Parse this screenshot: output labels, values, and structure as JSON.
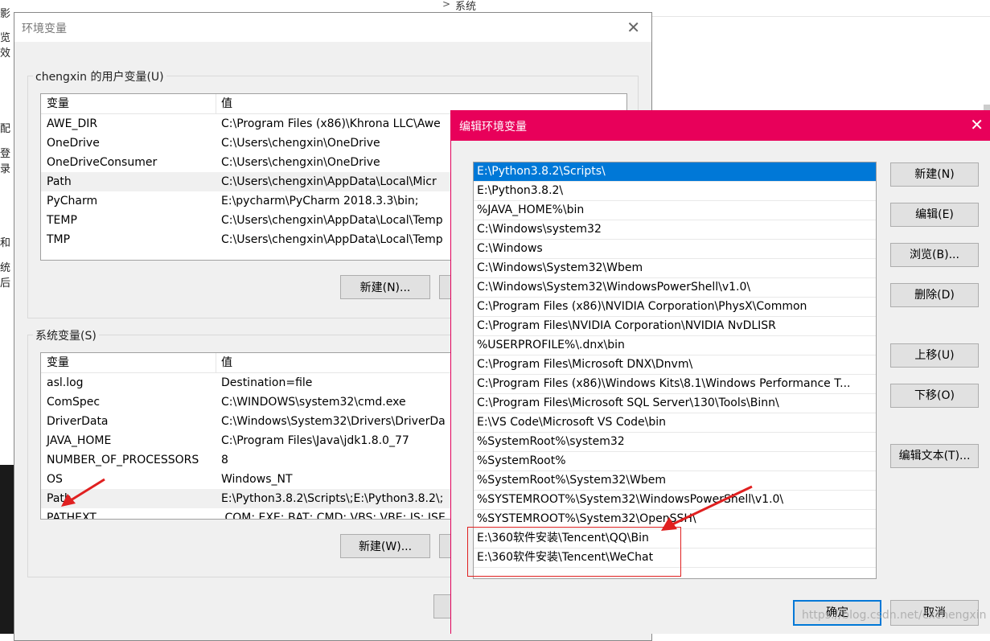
{
  "background": {
    "crumb_chevron": ">",
    "crumb_label": "系统",
    "left_fragments": [
      "影",
      "览效",
      "配",
      "登录",
      "和",
      "统后"
    ]
  },
  "env_dialog": {
    "title": "环境变量",
    "close_glyph": "✕",
    "user_vars": {
      "legend": "chengxin 的用户变量(U)",
      "headers": [
        "变量",
        "值"
      ],
      "rows": [
        {
          "name": "AWE_DIR",
          "value": "C:\\Program Files (x86)\\Khrona LLC\\Awe"
        },
        {
          "name": "OneDrive",
          "value": "C:\\Users\\chengxin\\OneDrive"
        },
        {
          "name": "OneDriveConsumer",
          "value": "C:\\Users\\chengxin\\OneDrive"
        },
        {
          "name": "Path",
          "value": "C:\\Users\\chengxin\\AppData\\Local\\Micr"
        },
        {
          "name": "PyCharm",
          "value": "E:\\pycharm\\PyCharm 2018.3.3\\bin;"
        },
        {
          "name": "TEMP",
          "value": "C:\\Users\\chengxin\\AppData\\Local\\Temp"
        },
        {
          "name": "TMP",
          "value": "C:\\Users\\chengxin\\AppData\\Local\\Temp"
        }
      ],
      "selected_row": 3,
      "new_button": "新建(N)..."
    },
    "system_vars": {
      "legend": "系统变量(S)",
      "headers": [
        "变量",
        "值"
      ],
      "rows": [
        {
          "name": "asl.log",
          "value": "Destination=file"
        },
        {
          "name": "ComSpec",
          "value": "C:\\WINDOWS\\system32\\cmd.exe"
        },
        {
          "name": "DriverData",
          "value": "C:\\Windows\\System32\\Drivers\\DriverDa"
        },
        {
          "name": "JAVA_HOME",
          "value": "C:\\Program Files\\Java\\jdk1.8.0_77"
        },
        {
          "name": "NUMBER_OF_PROCESSORS",
          "value": "8"
        },
        {
          "name": "OS",
          "value": "Windows_NT"
        },
        {
          "name": "Path",
          "value": "E:\\Python3.8.2\\Scripts\\;E:\\Python3.8.2\\;"
        },
        {
          "name": "PATHEXT",
          "value": ".COM;.EXE;.BAT;.CMD;.VBS;.VBE;.JS;.JSE"
        }
      ],
      "selected_row": 6,
      "new_button": "新建(W)..."
    }
  },
  "edit_dialog": {
    "title": "编辑环境变量",
    "close_glyph": "✕",
    "entries": [
      "E:\\Python3.8.2\\Scripts\\",
      "E:\\Python3.8.2\\",
      "%JAVA_HOME%\\bin",
      "C:\\Windows\\system32",
      "C:\\Windows",
      "C:\\Windows\\System32\\Wbem",
      "C:\\Windows\\System32\\WindowsPowerShell\\v1.0\\",
      "C:\\Program Files (x86)\\NVIDIA Corporation\\PhysX\\Common",
      "C:\\Program Files\\NVIDIA Corporation\\NVIDIA NvDLISR",
      "%USERPROFILE%\\.dnx\\bin",
      "C:\\Program Files\\Microsoft DNX\\Dnvm\\",
      "C:\\Program Files (x86)\\Windows Kits\\8.1\\Windows Performance T...",
      "C:\\Program Files\\Microsoft SQL Server\\130\\Tools\\Binn\\",
      "E:\\VS Code\\Microsoft VS Code\\bin",
      "%SystemRoot%\\system32",
      "%SystemRoot%",
      "%SystemRoot%\\System32\\Wbem",
      "%SYSTEMROOT%\\System32\\WindowsPowerShell\\v1.0\\",
      "%SYSTEMROOT%\\System32\\OpenSSH\\",
      "E:\\360软件安装\\Tencent\\QQ\\Bin",
      "E:\\360软件安装\\Tencent\\WeChat"
    ],
    "selected_index": 0,
    "buttons": {
      "new": "新建(N)",
      "edit": "编辑(E)",
      "browse": "浏览(B)...",
      "delete": "删除(D)",
      "move_up": "上移(U)",
      "move_down": "下移(O)",
      "edit_text": "编辑文本(T)...",
      "ok": "确定",
      "cancel": "取消"
    }
  },
  "colors": {
    "accent_titlebar": "#e8005a",
    "selection": "#0078d7",
    "annotation_red": "#e02020"
  },
  "watermark": "https://blog.csdn.net/cxchengxin"
}
